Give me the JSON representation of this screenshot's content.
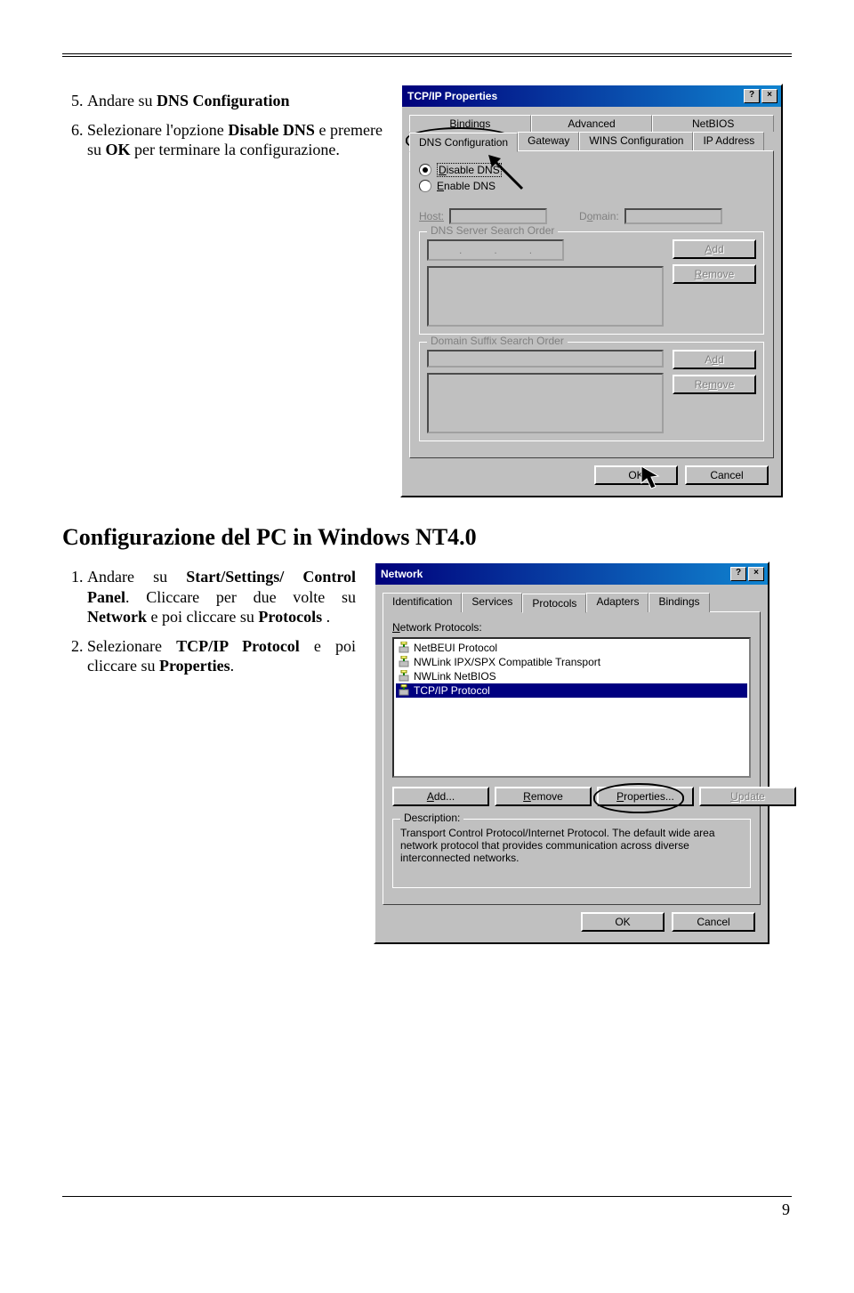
{
  "page_number": "9",
  "step5": {
    "num": "5.",
    "prefix": "Andare su ",
    "bold": "DNS Configuration"
  },
  "step6": {
    "num": "6.",
    "t1": "Selezionare l'opzione ",
    "b1": "Disable DNS",
    "t2": " e premere su ",
    "b2": "OK",
    "t3": " per terminare la configurazione."
  },
  "section2_title": "Configurazione del PC in Windows NT4.0",
  "nt_step1": {
    "num": "1.",
    "t1": "Andare su ",
    "b1": "Start/Settings/ Control Panel",
    "t2": ". Cliccare per due volte su ",
    "b2": "Network",
    "t3": " e poi cliccare su ",
    "b3": "Protocols",
    "t4": " ."
  },
  "nt_step2": {
    "num": "2.",
    "t1": "Selezionare ",
    "b1": "TCP/IP Protocol",
    "t2": " e poi cliccare su ",
    "b2": "Properties",
    "t3": "."
  },
  "dlg1": {
    "title": "TCP/IP Properties",
    "help_btn": "?",
    "close_btn": "×",
    "tabs_row1": [
      "Bindings",
      "Advanced",
      "NetBIOS"
    ],
    "tabs_row2": [
      "DNS Configuration",
      "Gateway",
      "WINS Configuration",
      "IP Address"
    ],
    "radio_disable": "Disable DNS",
    "radio_enable": "Enable DNS",
    "host_label": "Host:",
    "domain_label": "Domain:",
    "dns_order_legend": "DNS Server Search Order",
    "suffix_legend": "Domain Suffix Search Order",
    "add_btn": "Add",
    "remove_btn": "Remove",
    "ok_btn": "OK",
    "cancel_btn": "Cancel"
  },
  "dlg2": {
    "title": "Network",
    "help_btn": "?",
    "close_btn": "×",
    "tabs": [
      "Identification",
      "Services",
      "Protocols",
      "Adapters",
      "Bindings"
    ],
    "list_label": "Network Protocols:",
    "items": [
      "NetBEUI Protocol",
      "NWLink IPX/SPX Compatible Transport",
      "NWLink NetBIOS",
      "TCP/IP Protocol"
    ],
    "add_btn": "Add...",
    "remove_btn": "Remove",
    "properties_btn": "Properties...",
    "update_btn": "Update",
    "desc_legend": "Description:",
    "desc_text": "Transport Control Protocol/Internet Protocol. The default wide area network protocol that provides communication across diverse interconnected networks.",
    "ok_btn": "OK",
    "cancel_btn": "Cancel"
  }
}
